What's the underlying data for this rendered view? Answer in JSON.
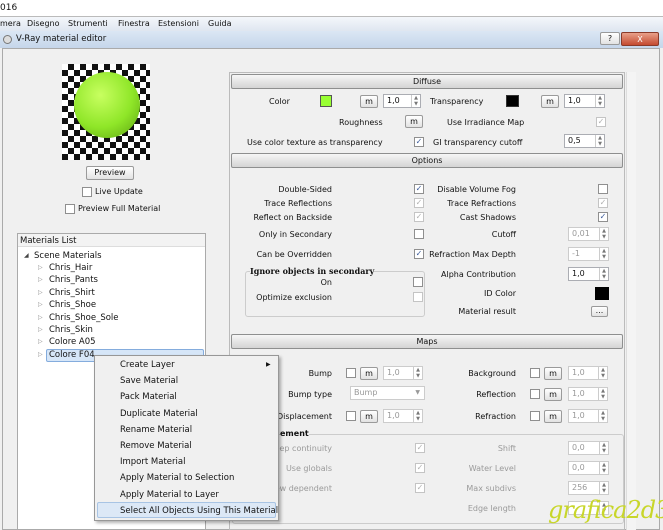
{
  "app": {
    "title_fragment": "016",
    "menu": [
      "mera",
      "Disegno",
      "Strumenti",
      "Finestra",
      "Estensioni",
      "Guida"
    ]
  },
  "dialog": {
    "title": "V-Ray material editor",
    "help": "?",
    "close": "X"
  },
  "left": {
    "preview_button": "Preview",
    "live_update": "Live Update",
    "preview_full": "Preview Full Material",
    "materials_list": {
      "header": "Materials List",
      "root": "Scene Materials",
      "items": [
        "Chris_Hair",
        "Chris_Pants",
        "Chris_Shirt",
        "Chris_Shoe",
        "Chris_Shoe_Sole",
        "Chris_Skin",
        "Colore A05",
        "Colore F04"
      ],
      "selected": "Colore F04"
    }
  },
  "diffuse": {
    "header": "Diffuse",
    "color_label": "Color",
    "color": "#99ff33",
    "m": "m",
    "color_value": "1,0",
    "transparency_label": "Transparency",
    "transparency_color": "#000000",
    "transparency_value": "1,0",
    "roughness_label": "Roughness",
    "irradiance_label": "Use Irradiance Map",
    "color_tex_label": "Use color texture as transparency",
    "gi_cutoff_label": "GI transparency cutoff",
    "gi_cutoff_value": "0,5"
  },
  "options": {
    "header": "Options",
    "left": [
      "Double-Sided",
      "Trace Reflections",
      "Reflect on Backside",
      "Only in Secondary",
      "Can be Overridden"
    ],
    "right": [
      "Disable Volume Fog",
      "Trace Refractions",
      "Cast Shadows"
    ],
    "ignore_group": "Ignore objects in secondary",
    "on": "On",
    "optimize": "Optimize exclusion",
    "cutoff_label": "Cutoff",
    "cutoff_value": "0,01",
    "max_depth_label": "Refraction Max Depth",
    "max_depth_value": "-1",
    "alpha_label": "Alpha Contribution",
    "alpha_value": "1,0",
    "id_color_label": "ID Color",
    "id_color": "#000000",
    "material_result_label": "Material result",
    "material_result_button": "..."
  },
  "maps": {
    "header": "Maps",
    "bump": "Bump",
    "bump_type": "Bump type",
    "bump_type_value": "Bump",
    "displacement": "Displacement",
    "background": "Background",
    "reflection": "Reflection",
    "refraction": "Refraction",
    "value": "1,0",
    "disp_group": "ement",
    "keep": "eep continuity",
    "globals": "Use globals",
    "view": "ew dependent",
    "shift": "Shift",
    "shift_value": "0,0",
    "water": "Water Level",
    "water_value": "0,0",
    "subdivs": "Max subdivs",
    "subdivs_value": "256",
    "edge": "Edge length"
  },
  "context_menu": [
    "Create Layer",
    "Save Material",
    "Pack Material",
    "Duplicate Material",
    "Rename Material",
    "Remove Material",
    "Import Material",
    "Apply Material to Selection",
    "Apply Material to Layer",
    "Select All Objects Using This Material"
  ],
  "watermark": "grafica2d3d"
}
